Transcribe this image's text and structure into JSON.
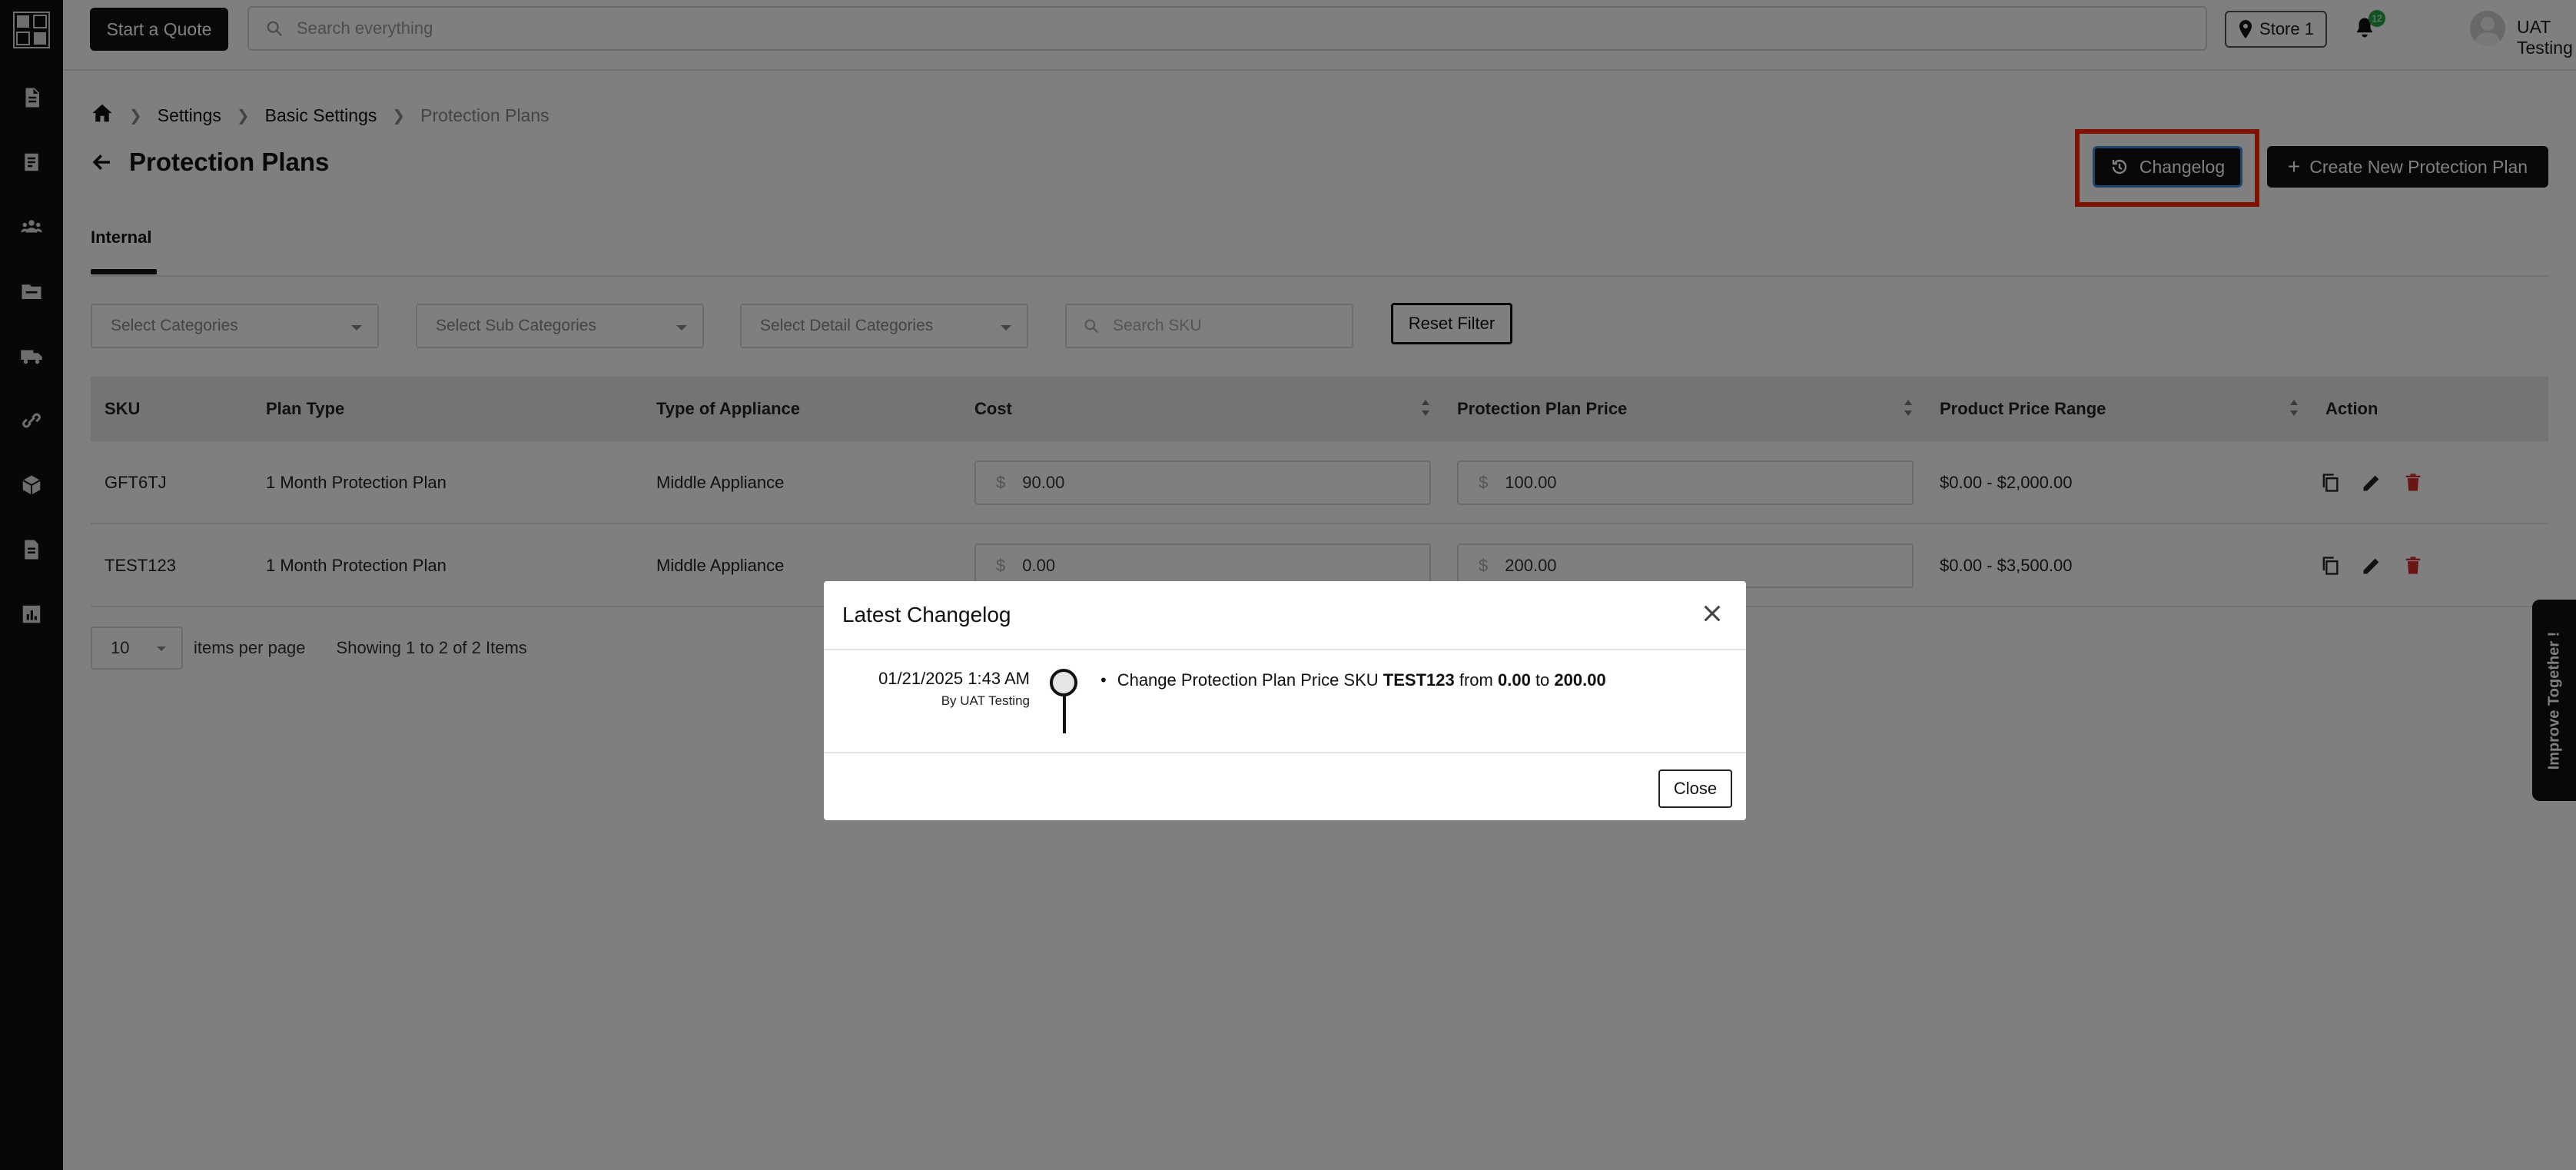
{
  "topbar": {
    "quote_label": "Start a Quote",
    "search_placeholder": "Search everything",
    "store_label": "Store 1",
    "notification_count": "12",
    "user_name": "UAT Testing"
  },
  "breadcrumb": {
    "items": [
      "Settings",
      "Basic Settings",
      "Protection Plans"
    ]
  },
  "page": {
    "title": "Protection Plans",
    "changelog_label": "Changelog",
    "create_label": "Create New Protection Plan",
    "tab_internal": "Internal"
  },
  "filters": {
    "categories": "Select Categories",
    "sub_categories": "Select Sub Categories",
    "detail_categories": "Select Detail Categories",
    "sku_placeholder": "Search SKU",
    "reset_label": "Reset Filter"
  },
  "table": {
    "headers": [
      "SKU",
      "Plan Type",
      "Type of Appliance",
      "Cost",
      "Protection Plan Price",
      "Product Price Range",
      "Action"
    ],
    "currency_symbol": "$",
    "rows": [
      {
        "sku": "GFT6TJ",
        "plan_type": "1 Month Protection Plan",
        "appliance": "Middle Appliance",
        "cost": "90.00",
        "price": "100.00",
        "range": "$0.00 - $2,000.00"
      },
      {
        "sku": "TEST123",
        "plan_type": "1 Month Protection Plan",
        "appliance": "Middle Appliance",
        "cost": "0.00",
        "price": "200.00",
        "range": "$0.00 - $3,500.00"
      }
    ]
  },
  "pager": {
    "per_page": "10",
    "per_page_label": "items per page",
    "showing": "Showing 1 to 2 of 2 Items"
  },
  "feedback": {
    "label": "Improve Together !"
  },
  "modal": {
    "title": "Latest Changelog",
    "entry": {
      "date": "01/21/2025 1:43 AM",
      "by": "By UAT Testing",
      "text_prefix": "Change Protection Plan Price SKU",
      "sku": "TEST123",
      "from_word": "from",
      "from_value": "0.00",
      "to_word": "to",
      "to_value": "200.00"
    },
    "close_label": "Close"
  },
  "colors": {
    "sidebar_bg": "#0f0f0f",
    "accent": "#111111",
    "highlight_frame": "#ff2400",
    "delete_icon": "#d62828",
    "badge": "#27a745"
  },
  "icons": {
    "sidebar": [
      "quote-icon",
      "invoice-icon",
      "users-icon",
      "folder-icon",
      "truck-icon",
      "link-icon",
      "box-icon",
      "document-icon",
      "chart-icon"
    ],
    "row_actions": [
      "copy-icon",
      "edit-icon",
      "delete-icon"
    ]
  }
}
